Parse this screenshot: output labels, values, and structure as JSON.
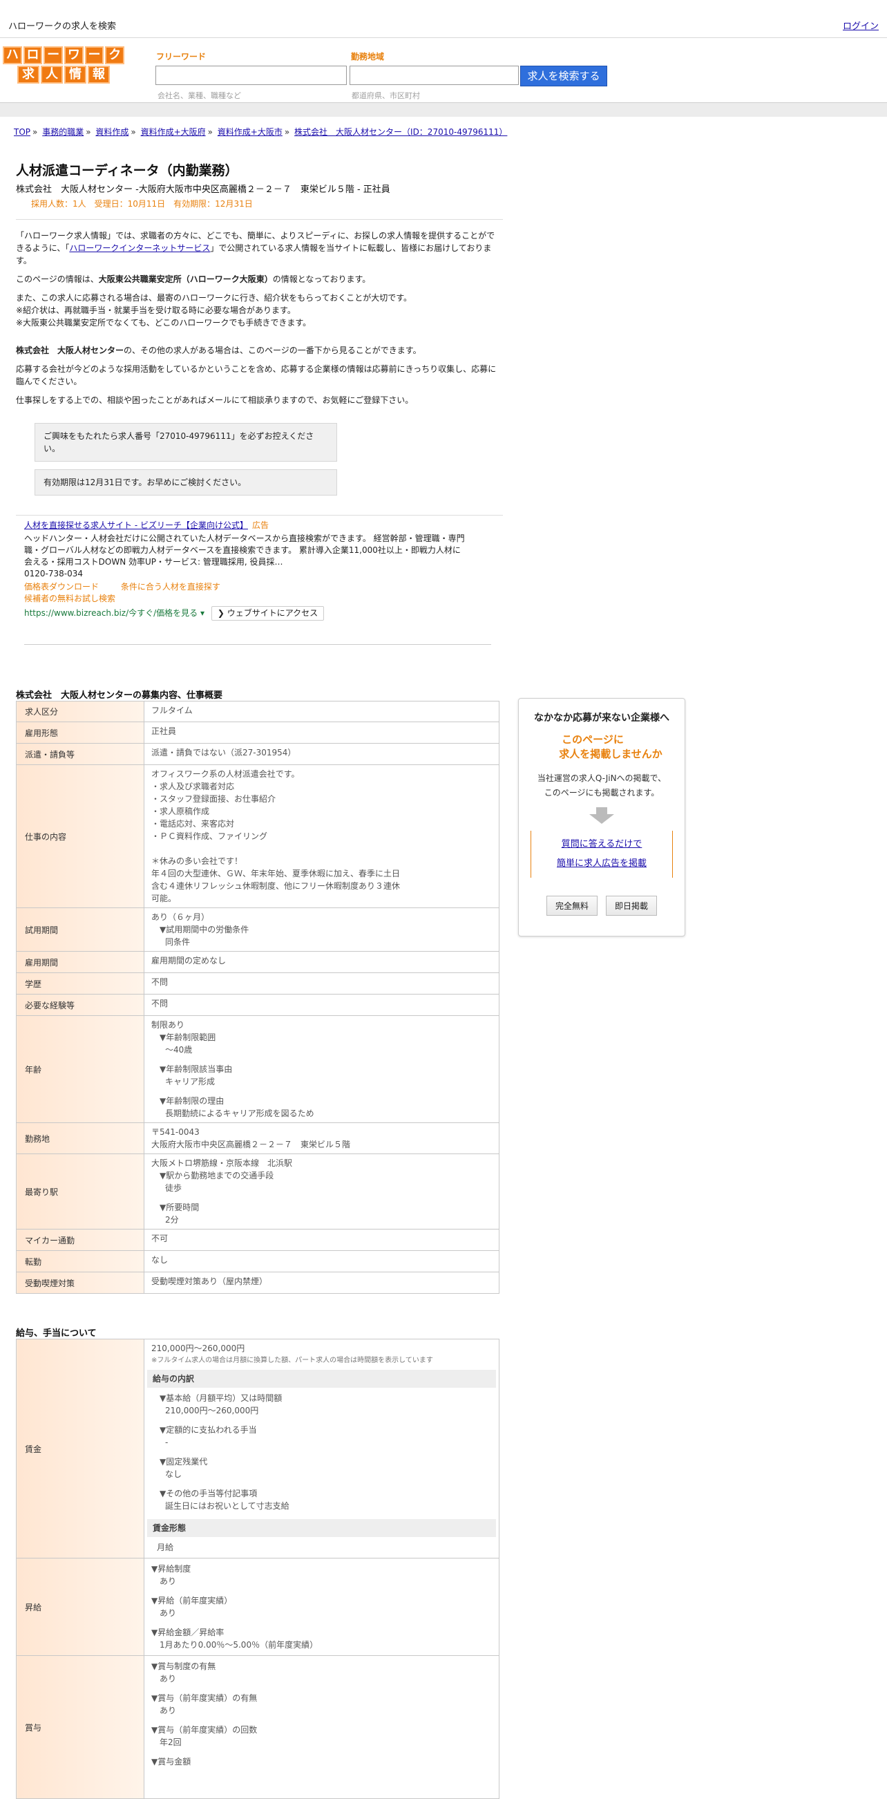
{
  "topbar": {
    "site_title": "ハローワークの求人を検索",
    "login": "ログイン"
  },
  "logo": {
    "row1": [
      "ハ",
      "ロ",
      "ー",
      "ワ",
      "ー",
      "ク"
    ],
    "row2": [
      "求",
      "人",
      "情",
      "報"
    ]
  },
  "search": {
    "freeword_label": "フリーワード",
    "freeword_value": "",
    "freeword_hint": "会社名、業種、職種など",
    "area_label": "勤務地域",
    "area_value": "",
    "area_hint": "都道府県、市区町村",
    "button": "求人を検索する"
  },
  "breadcrumb": [
    "TOP",
    "事務的職業",
    "資料作成",
    "資料作成+大阪府",
    "資料作成+大阪市",
    "株式会社　大阪人材センター（ID：27010-49796111）"
  ],
  "job": {
    "title": "人材派遣コーディネータ（内勤業務）",
    "company_line": "株式会社　大阪人材センター -大阪府大阪市中央区高麗橋２－２－７　東栄ビル５階 - 正社員",
    "meta": "採用人数：1人　受理日：10月11日　有効期限：12月31日"
  },
  "intro": {
    "p1_a": "「ハローワーク求人情報」では、求職者の方々に、どこでも、簡単に、よりスピーディに、お探しの求人情報を提供することができるように、「",
    "p1_link": "ハローワークインターネットサービス",
    "p1_b": "」で公開されている求人情報を当サイトに転載し、皆様にお届けしております。",
    "p2_a": "このページの情報は、",
    "p2_bold": "大阪東公共職業安定所（ハローワーク大阪東）",
    "p2_b": "の情報となっております。",
    "p3_1": "また、この求人に応募される場合は、最寄のハローワークに行き、紹介状をもらっておくことが大切です。",
    "p3_2": "※紹介状は、再就職手当・就業手当を受け取る時に必要な場合があります。",
    "p3_3": "※大阪東公共職業安定所でなくても、どこのハローワークでも手続きできます。",
    "p4_bold": "株式会社　大阪人材センター",
    "p4_b": "の、その他の求人がある場合は、このページの一番下から見ることができます。",
    "p5": "応募する会社が今どのような採用活動をしているかということを含め、応募する企業様の情報は応募前にきっちり収集し、応募に臨んでください。",
    "p6": "仕事探しをする上での、相談や困ったことがあればメールにて相談承りますので、お気軽にご登録下さい。"
  },
  "notices": {
    "n1": "ご興味をもたれたら求人番号「27010-49796111」を必ずお控えください。",
    "n2": "有効期限は12月31日です。お早めにご検討ください。"
  },
  "ad": {
    "title": "人材を直接探せる求人サイト - ビズリーチ【企業向け公式】",
    "tag": "広告",
    "desc": "ヘッドハンター・人材会社だけに公開されていた人材データベースから直接検索ができます。 経営幹部・管理職・専門職・グローバル人材などの即戦力人材データベースを直接検索できます。 累計導入企業11,000社以上・即戦力人材に会える・採用コストDOWN 効率UP・サービス: 管理職採用, 役員採…",
    "phone": "0120-738-034",
    "link1": "価格表ダウンロード",
    "link2": "条件に合う人材を直接探す",
    "link3": "候補者の無料お試し検索",
    "url": "https://www.bizreach.biz/今すぐ/価格を見る",
    "visit": "ウェブサイトにアクセス"
  },
  "section1": {
    "heading": "株式会社　大阪人材センターの募集内容、仕事概要",
    "rows": {
      "kubun": {
        "label": "求人区分",
        "value": "フルタイム"
      },
      "keitai": {
        "label": "雇用形態",
        "value": "正社員"
      },
      "haken": {
        "label": "派遣・請負等",
        "value": "派遣・請負ではない（派27-301954）"
      },
      "shigoto": {
        "label": "仕事の内容",
        "lines": [
          "オフィスワーク系の人材派遣会社です。",
          "・求人及び求職者対応",
          "・スタッフ登録面接、お仕事紹介",
          "・求人原稿作成",
          "・電話応対、来客応対",
          "・ＰＣ資料作成、ファイリング",
          "",
          "＊休みの多い会社です！",
          "年４回の大型連休、ＧＷ、年末年始、夏季休暇に加え、春季に土日",
          "含む４連休リフレッシュ休暇制度、他にフリー休暇制度あり３連休",
          "可能。"
        ]
      },
      "shiyou": {
        "label": "試用期間",
        "v1": "あり（６ヶ月）",
        "v2": "▼試用期間中の労働条件",
        "v3": "同条件"
      },
      "kikan": {
        "label": "雇用期間",
        "value": "雇用期間の定めなし"
      },
      "gakureki": {
        "label": "学歴",
        "value": "不問"
      },
      "keiken": {
        "label": "必要な経験等",
        "value": "不問"
      },
      "nenrei": {
        "label": "年齢",
        "v1": "制限あり",
        "v2": "▼年齢制限範囲",
        "v3": "〜40歳",
        "v4": "▼年齢制限該当事由",
        "v5": "キャリア形成",
        "v6": "▼年齢制限の理由",
        "v7": "長期勤続によるキャリア形成を図るため"
      },
      "kinmuchi": {
        "label": "勤務地",
        "v1": "〒541-0043",
        "v2": "大阪府大阪市中央区高麗橋２－２－７　東栄ビル５階"
      },
      "eki": {
        "label": "最寄り駅",
        "v1": "大阪メトロ堺筋線・京阪本線　北浜駅",
        "v2": "▼駅から勤務地までの交通手段",
        "v3": "徒歩",
        "v4": "▼所要時間",
        "v5": "2分"
      },
      "maikaa": {
        "label": "マイカー通勤",
        "value": "不可"
      },
      "tenkin": {
        "label": "転勤",
        "value": "なし"
      },
      "kitsuen": {
        "label": "受動喫煙対策",
        "value": "受動喫煙対策あり（屋内禁煙）"
      }
    }
  },
  "section2": {
    "heading": "給与、手当について",
    "chingin": {
      "label": "賃金",
      "range": "210,000円〜260,000円",
      "note": "※フルタイム求人の場合は月額に換算した額、パート求人の場合は時間額を表示しています",
      "breakdown_head": "給与の内訳",
      "b1": "▼基本給（月額平均）又は時間額",
      "b1v": "210,000円〜260,000円",
      "b2": "▼定額的に支払われる手当",
      "b2v": "-",
      "b3": "▼固定残業代",
      "b3v": "なし",
      "b4": "▼その他の手当等付記事項",
      "b4v": "誕生日にはお祝いとして寸志支給",
      "form_head": "賃金形態",
      "form_value": "月給"
    },
    "shoukyu": {
      "label": "昇給",
      "s1": "▼昇給制度",
      "s1v": "あり",
      "s2": "▼昇給（前年度実績）",
      "s2v": "あり",
      "s3": "▼昇給金額／昇給率",
      "s3v": "1月あたり0.00％〜5.00％（前年度実績）"
    },
    "shouyo": {
      "label": "賞与",
      "y1": "▼賞与制度の有無",
      "y1v": "あり",
      "y2": "▼賞与（前年度実績）の有無",
      "y2v": "あり",
      "y3": "▼賞与（前年度実績）の回数",
      "y3v": "年2回",
      "y4": "▼賞与金額"
    }
  },
  "sidebox": {
    "title": "なかなか応募が来ない企業様へ",
    "orange1": "このページに",
    "orange2": "求人を掲載しませんか",
    "text1": "当社運営の求人Q-JiNへの掲載で、",
    "text2": "このページにも掲載されます。",
    "link1": "質問に答えるだけで",
    "link2": "簡単に求人広告を掲載",
    "btn1": "完全無料",
    "btn2": "即日掲載"
  }
}
